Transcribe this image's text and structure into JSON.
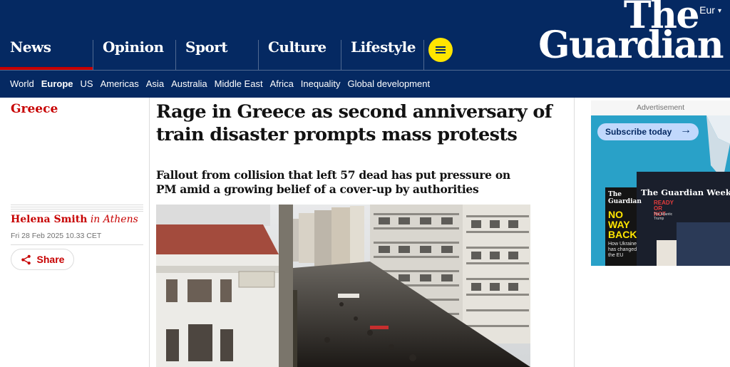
{
  "header": {
    "edition": "Eur",
    "logo_line1": "The",
    "logo_line2": "Guardian",
    "pillars": [
      "News",
      "Opinion",
      "Sport",
      "Culture",
      "Lifestyle"
    ],
    "subnav": [
      "World",
      "Europe",
      "US",
      "Americas",
      "Asia",
      "Australia",
      "Middle East",
      "Africa",
      "Inequality",
      "Global development"
    ],
    "active_pillar": "News",
    "active_subnav": "Europe"
  },
  "article": {
    "section": "Greece",
    "headline": "Rage in Greece as second anniversary of train disaster prompts mass protests",
    "standfirst": "Fallout from collision that left 57 dead has put pressure on PM amid a growing belief of a cover-up by authorities",
    "author": "Helena Smith",
    "author_location": "in Athens",
    "date": "Fri 28 Feb 2025 10.33 CET",
    "share_label": "Share"
  },
  "ad": {
    "label": "Advertisement",
    "cta": "Subscribe today",
    "cover_back": {
      "masthead": "The Guardian",
      "headline": "NO WAY BACK",
      "sub": "How Ukraine has changed the EU"
    },
    "cover_front": {
      "masthead": "The Guardian Weekly",
      "headline": "READY OR NOT",
      "sub": "The Atlantic Trump"
    }
  },
  "colors": {
    "brand_blue": "#052962",
    "accent_red": "#c70000",
    "menu_yellow": "#ffe500"
  }
}
